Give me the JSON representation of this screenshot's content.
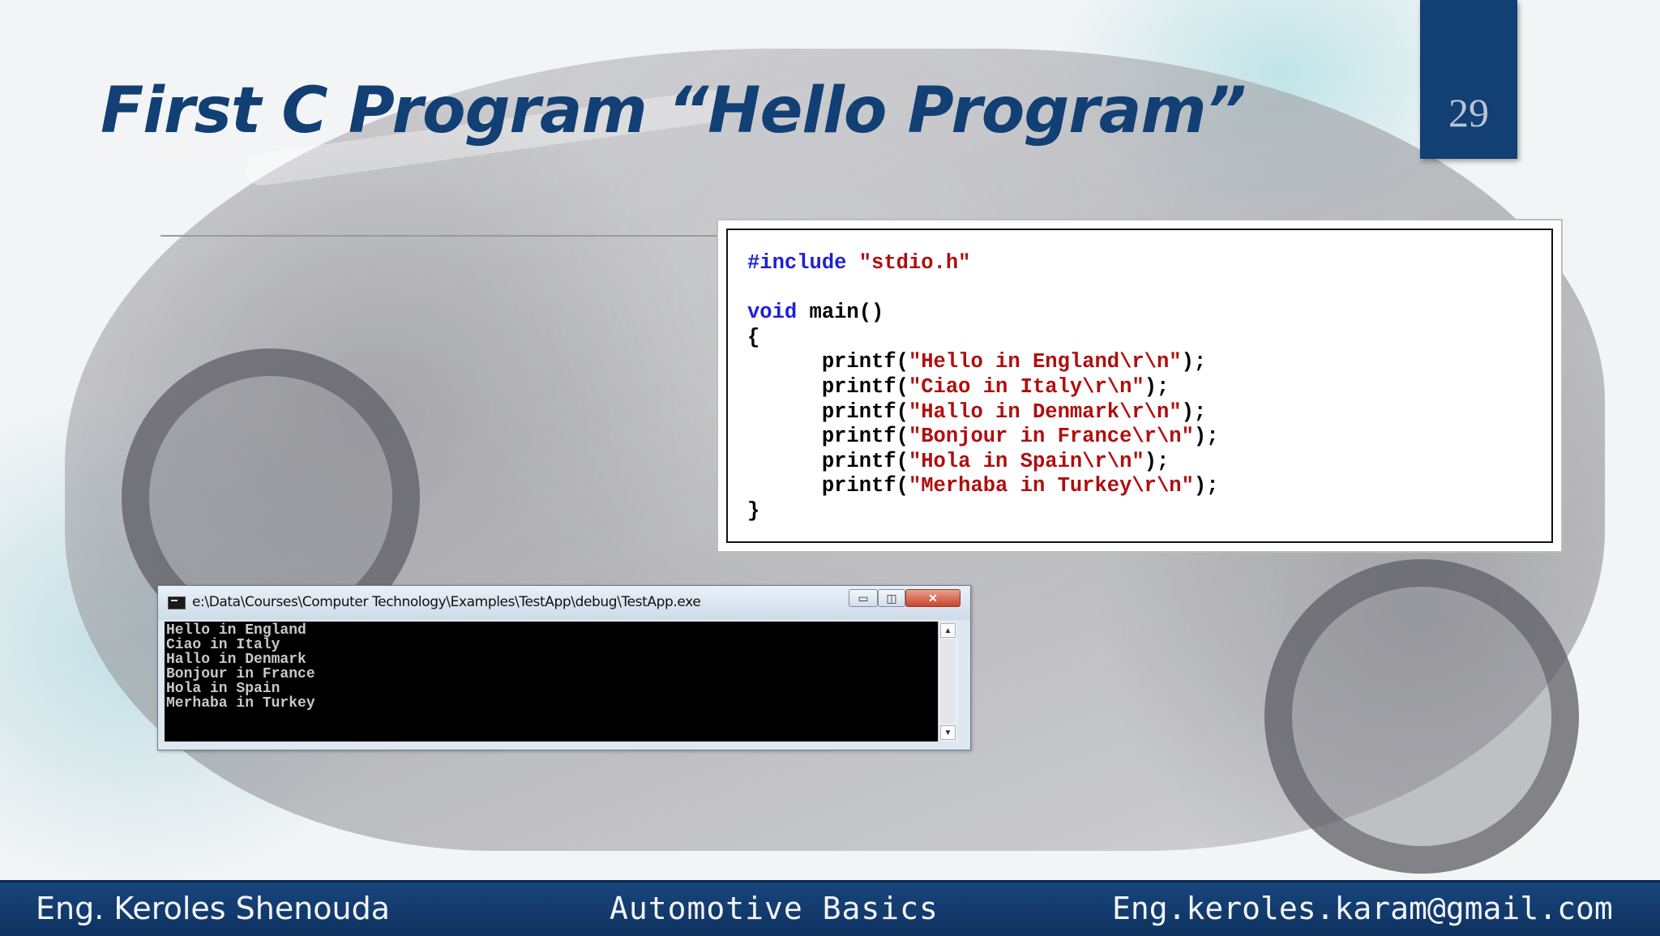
{
  "slide": {
    "title": "First C Program “Hello Program”",
    "page_number": "29"
  },
  "code": {
    "lines": [
      {
        "parts": [
          {
            "t": "#include",
            "c": "kw"
          },
          {
            "t": " ",
            "c": ""
          },
          {
            "t": "\"stdio.h\"",
            "c": "str"
          }
        ]
      },
      {
        "parts": [
          {
            "t": "",
            "c": ""
          }
        ]
      },
      {
        "parts": [
          {
            "t": "void",
            "c": "kw"
          },
          {
            "t": " main()",
            "c": ""
          }
        ]
      },
      {
        "parts": [
          {
            "t": "{",
            "c": ""
          }
        ]
      },
      {
        "parts": [
          {
            "t": "      printf(",
            "c": ""
          },
          {
            "t": "\"Hello in England\\r\\n\"",
            "c": "str"
          },
          {
            "t": ");",
            "c": ""
          }
        ]
      },
      {
        "parts": [
          {
            "t": "      printf(",
            "c": ""
          },
          {
            "t": "\"Ciao in Italy\\r\\n\"",
            "c": "str"
          },
          {
            "t": ");",
            "c": ""
          }
        ]
      },
      {
        "parts": [
          {
            "t": "      printf(",
            "c": ""
          },
          {
            "t": "\"Hallo in Denmark\\r\\n\"",
            "c": "str"
          },
          {
            "t": ");",
            "c": ""
          }
        ]
      },
      {
        "parts": [
          {
            "t": "      printf(",
            "c": ""
          },
          {
            "t": "\"Bonjour in France\\r\\n\"",
            "c": "str"
          },
          {
            "t": ");",
            "c": ""
          }
        ]
      },
      {
        "parts": [
          {
            "t": "      printf(",
            "c": ""
          },
          {
            "t": "\"Hola in Spain\\r\\n\"",
            "c": "str"
          },
          {
            "t": ");",
            "c": ""
          }
        ]
      },
      {
        "parts": [
          {
            "t": "      printf(",
            "c": ""
          },
          {
            "t": "\"Merhaba in Turkey\\r\\n\"",
            "c": "str"
          },
          {
            "t": ");",
            "c": ""
          }
        ]
      },
      {
        "parts": [
          {
            "t": "}",
            "c": ""
          }
        ]
      }
    ]
  },
  "console": {
    "title": "e:\\Data\\Courses\\Computer Technology\\Examples\\TestApp\\debug\\TestApp.exe",
    "icon": "console-window-icon",
    "minimize_glyph": "▭",
    "maximize_glyph": "◫",
    "close_glyph": "✕",
    "scroll_up_glyph": "▲",
    "scroll_down_glyph": "▼",
    "output": [
      "Hello in England",
      "Ciao in Italy",
      "Hallo in Denmark",
      "Bonjour in France",
      "Hola in Spain",
      "Merhaba in Turkey"
    ]
  },
  "footer": {
    "author": "Eng. Keroles Shenouda",
    "course": "Automotive Basics",
    "email": "Eng.keroles.karam@gmail.com"
  },
  "colors": {
    "title": "#123f74",
    "footer_bg": "#123f74",
    "keyword": "#1f1fd6",
    "string": "#b00e0e"
  }
}
